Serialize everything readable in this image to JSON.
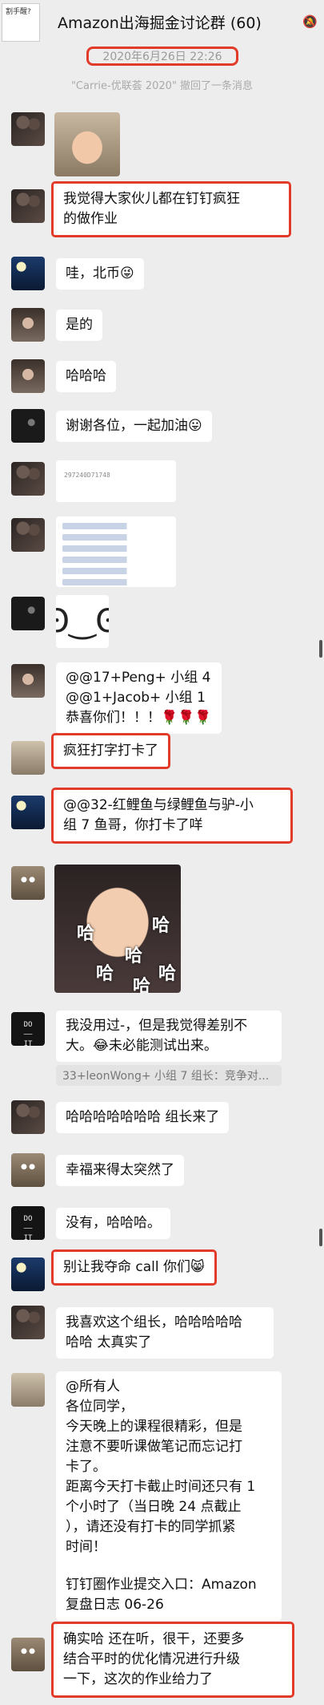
{
  "header": {
    "group_title": "Amazon出海掘金讨论群 (60)",
    "avatar_caption": "割手醒?",
    "mute_icon": "bell-off-icon"
  },
  "timestamp": "2020年6月26日 22:26",
  "recall_notice": "\"Carrie-优联荟 2020\" 撤回了一条消息",
  "messages": {
    "m1": "我觉得大家伙儿都在钉钉疯狂",
    "m1b": "的做作业",
    "m2": "哇，北币😜",
    "m3": "是的",
    "m4": "哈哈哈",
    "m5": "谢谢各位，一起加油😛",
    "m6": "297240D71748",
    "m7a": "@@17+Peng+ 小组 4",
    "m7b": "@@1+Jacob+ 小组 1",
    "m7c": "恭喜你们！！！🌹🌹🌹",
    "m8": "疯狂打字打卡了",
    "m9a": "@@32-红鲤鱼与绿鲤鱼与驴-小",
    "m9b": "组 7 鱼哥，你打卡了咩",
    "m10a": "我没用过-，但是我觉得差别不",
    "m10b": "大。😂未必能测试出来。",
    "m10q": "33+leonWong+ 小组 7 组长：竞争对...",
    "m11": "哈哈哈哈哈哈哈  组长来了",
    "m12": "幸福来得太突然了",
    "m13": "没有，哈哈哈。",
    "m14": "别让我夺命 call 你们😸",
    "m15a": "我喜欢这个组长，哈哈哈哈哈",
    "m15b": "哈哈  太真实了",
    "m16": [
      "@所有人",
      "各位同学，",
      "今天晚上的课程很精彩，但是",
      "注意不要听课做笔记而忘记打",
      "卡了。",
      "距离今天打卡截止时间还只有 1",
      "个小时了（当日晚 24 点截止",
      "），请还没有打卡的同学抓紧",
      "时间！",
      "",
      "钉钉圈作业提交入口：Amazon",
      " 复盘日志 06-26"
    ],
    "m17a": "确实哈  还在听，很干，还要多",
    "m17b": "结合平时的优化情况进行升级",
    "m17c": "一下，这次的作业给力了"
  },
  "sticker_laugh": "哈",
  "sticker_face": "ʘ‿ʘ",
  "do_avatar": "DO\n——\nIT"
}
